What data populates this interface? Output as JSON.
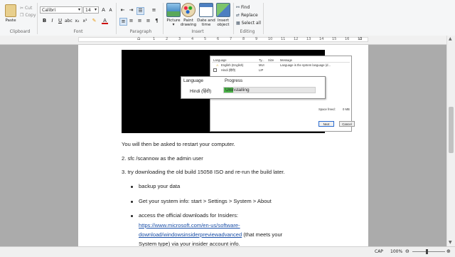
{
  "ribbon": {
    "clipboard": {
      "paste_label": "Paste",
      "cut_label": "Cut",
      "copy_label": "Copy",
      "group_label": "Clipboard"
    },
    "font": {
      "family": "Calibri",
      "size": "14",
      "group_label": "Font"
    },
    "paragraph": {
      "group_label": "Paragraph"
    },
    "insert": {
      "picture_label": "Picture",
      "paint_label_1": "Paint",
      "paint_label_2": "drawing",
      "datetime_label_1": "Date and",
      "datetime_label_2": "time",
      "object_label_1": "Insert",
      "object_label_2": "object",
      "group_label": "Insert"
    },
    "editing": {
      "find_label": "Find",
      "replace_label": "Replace",
      "select_all_label": "Select all",
      "group_label": "Editing"
    }
  },
  "ruler": {
    "numbers": [
      "1",
      "2",
      "3",
      "4",
      "5",
      "6",
      "7",
      "8",
      "9",
      "10",
      "11",
      "12",
      "13",
      "14",
      "15",
      "16",
      "17"
    ]
  },
  "document": {
    "embedded_screenshot": {
      "table_headers": {
        "language": "Language",
        "type": "Ty...",
        "size": "Size",
        "message": "Message"
      },
      "row1": {
        "language": "English (English)",
        "type": "MUI",
        "message": "Language is the system language (d..."
      },
      "row2": {
        "language": "Hindi (हिंदी)",
        "type": "LIP"
      },
      "space_freed_label": "Space freed:",
      "space_freed_value": "0 MB",
      "next_button": "Next",
      "cancel_button": "Cancel",
      "popup": {
        "language_header": "Language",
        "progress_header": "Progress",
        "language_value": "Hindi (हिंदी)",
        "status_text": "Uninstalling",
        "progress_fraction": 0.1
      }
    },
    "paragraph_restart": "You will then be asked to restart your computer.",
    "item2": "2. sfc /scannow as the admin user",
    "item3": "3. try downloading the old build 15058 ISO and re-run the build later.",
    "bullet1": "backup your data",
    "bullet2": "Get your system info: start > Settings > System > About",
    "bullet3_line1": "access the official downloads for Insiders:",
    "bullet3_link1": "https://www.microsoft.com/en-us/software-",
    "bullet3_link2": "download/windowsinsiderpreviewadvanced",
    "bullet3_rest": " (that meets your",
    "bullet3_line3": "System type) via your insider account info."
  },
  "status_bar": {
    "caps": "CAP",
    "zoom": "100%"
  }
}
